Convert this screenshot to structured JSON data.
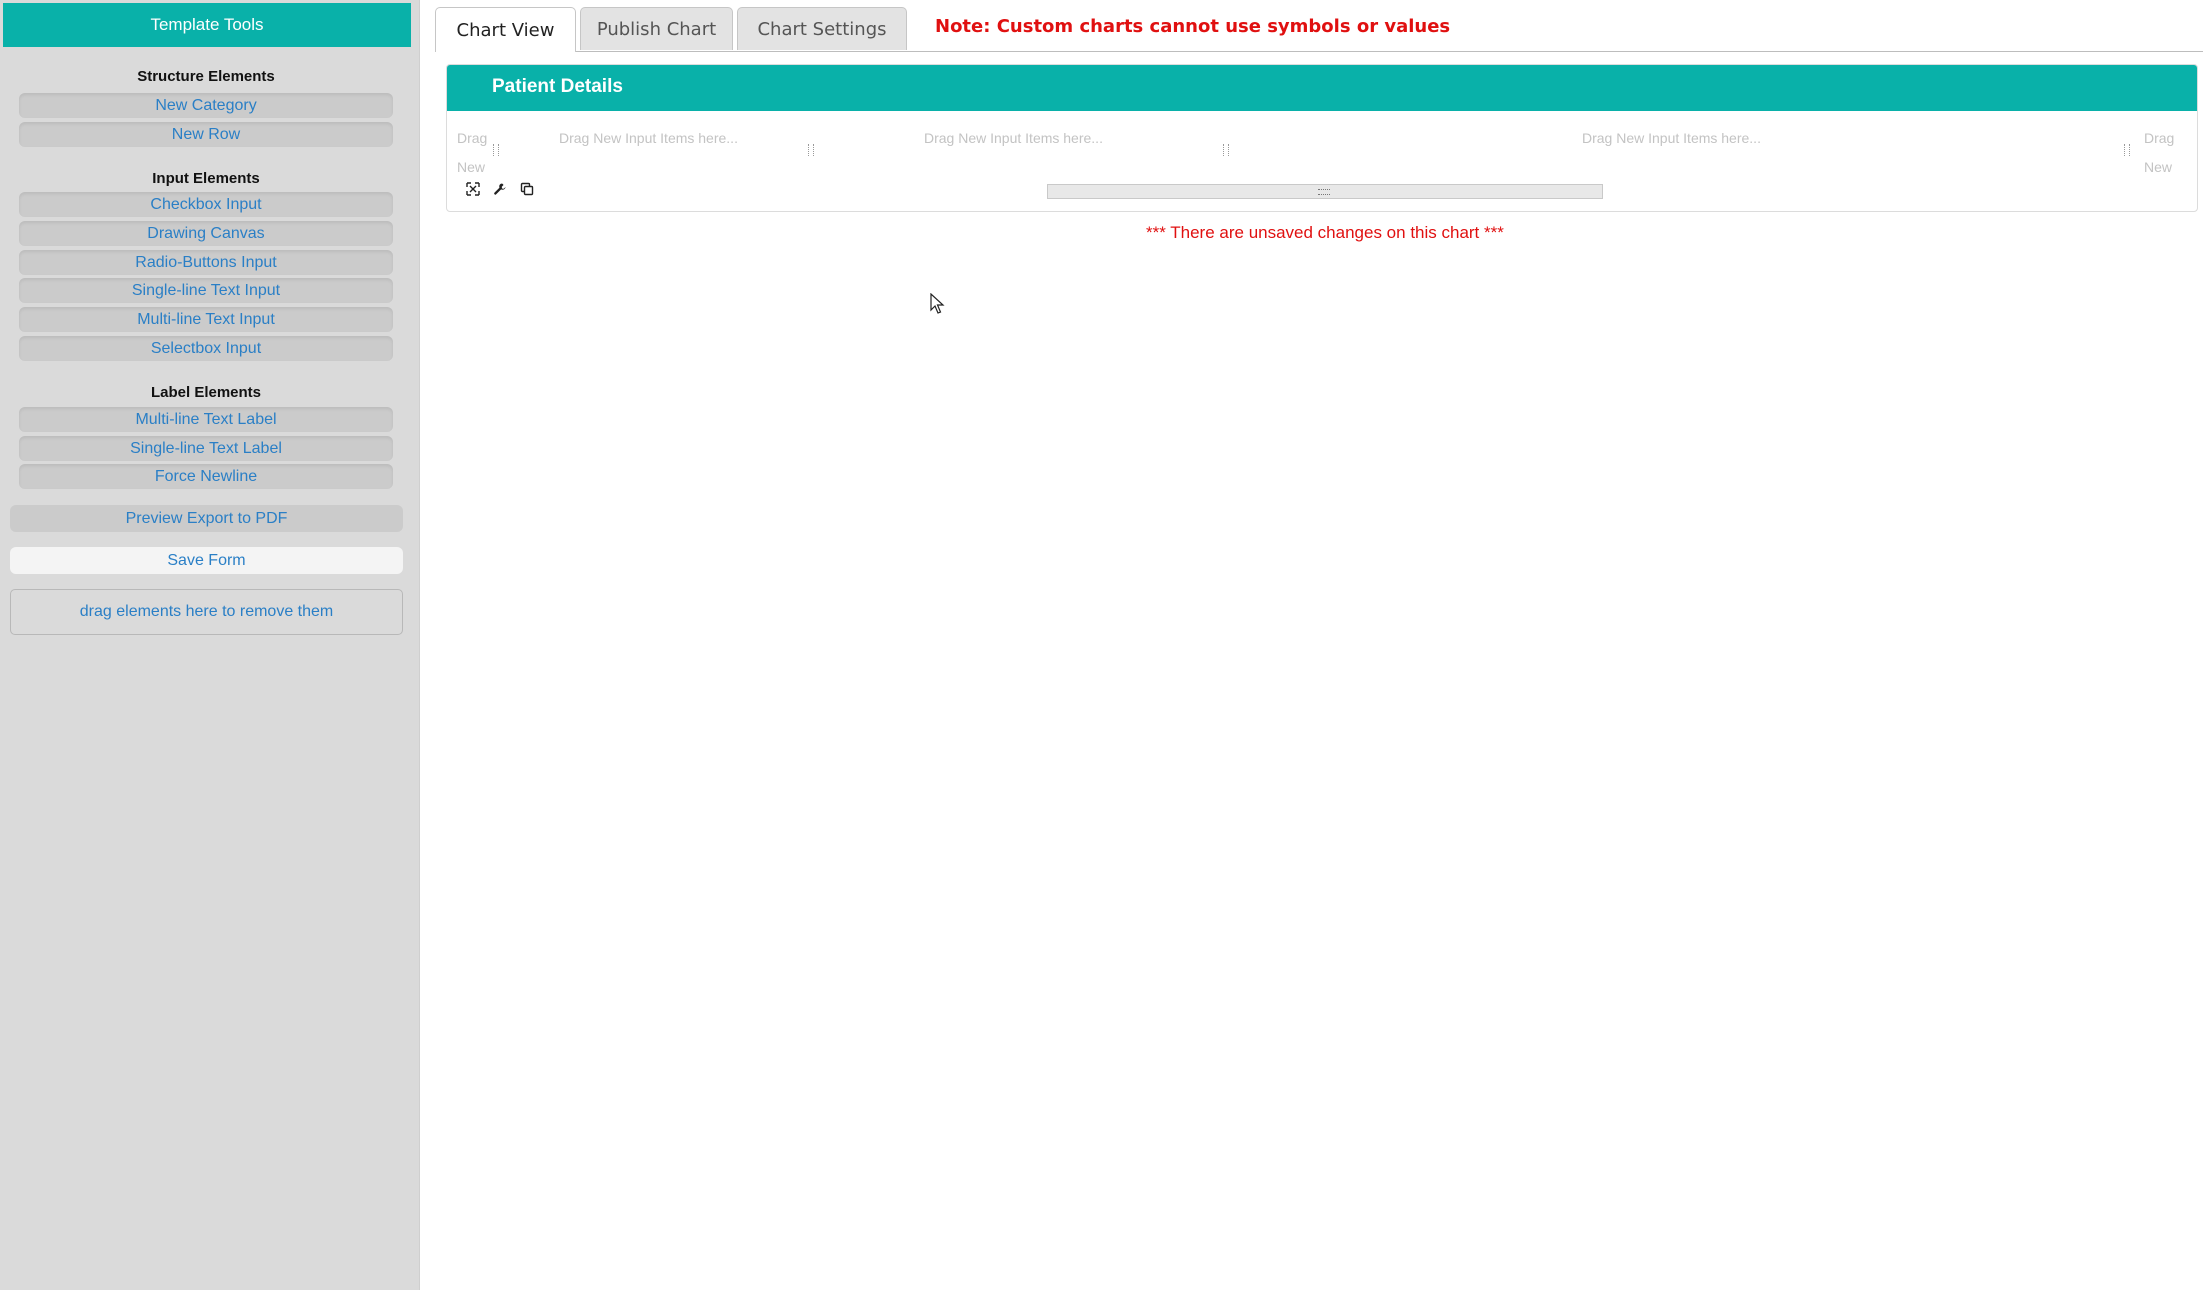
{
  "sidebar": {
    "title": "Template Tools",
    "structure": {
      "heading": "Structure Elements",
      "items": [
        "New Category",
        "New Row"
      ]
    },
    "input": {
      "heading": "Input Elements",
      "items": [
        "Checkbox Input",
        "Drawing Canvas",
        "Radio-Buttons Input",
        "Single-line Text Input",
        "Multi-line Text Input",
        "Selectbox Input"
      ]
    },
    "label": {
      "heading": "Label Elements",
      "items": [
        "Multi-line Text Label",
        "Single-line Text Label",
        "Force Newline"
      ]
    },
    "preview_label": "Preview Export to PDF",
    "save_label": "Save Form",
    "trash_label": "drag elements here to remove them"
  },
  "tabs": [
    "Chart View",
    "Publish Chart",
    "Chart Settings"
  ],
  "note": "Note: Custom charts cannot use symbols or values",
  "category": {
    "title": "Patient Details",
    "placeholders": {
      "left_top": "Drag",
      "left_bottom": "New",
      "col1": "Drag New Input Items here...",
      "col2": "Drag New Input Items here...",
      "col3": "Drag New Input Items here...",
      "right_top": "Drag",
      "right_bottom": "New"
    },
    "row_icons": [
      "expand-icon",
      "wrench-icon",
      "copy-icon"
    ]
  },
  "unsaved_message": "*** There are unsaved changes on this chart ***",
  "colors": {
    "accent": "#09b1a9",
    "link": "#2a7fc6",
    "warning": "#e01010"
  }
}
